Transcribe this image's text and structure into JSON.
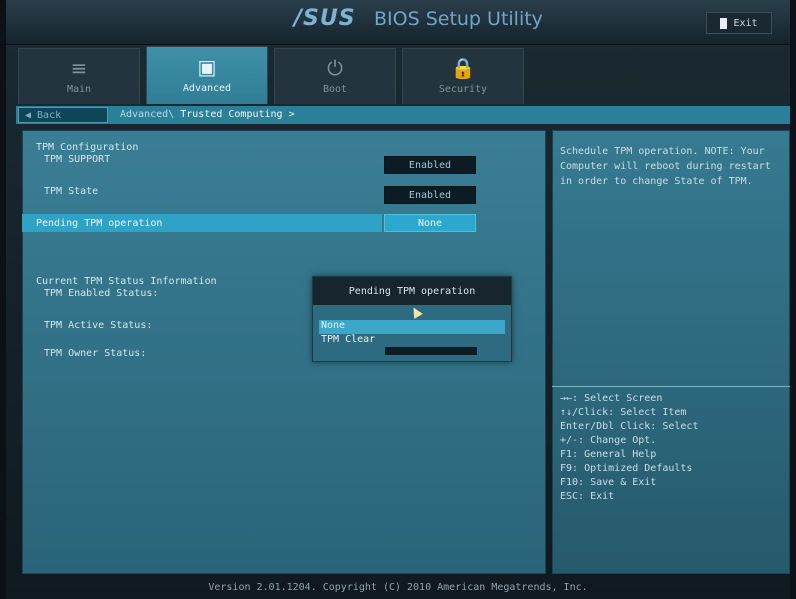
{
  "header": {
    "logo": "/SUS",
    "title": "BIOS Setup Utility",
    "exit_label": "Exit"
  },
  "tabs": [
    {
      "label": "Main",
      "icon": "≡"
    },
    {
      "label": "Advanced",
      "icon": "▣"
    },
    {
      "label": "Boot",
      "icon": "⏻"
    },
    {
      "label": "Security",
      "icon": "🔒"
    }
  ],
  "breadcrumb": {
    "back_label": "Back",
    "path_prefix": "Advanced\\",
    "path_current": "Trusted Computing >"
  },
  "config": {
    "section_title": "TPM Configuration",
    "items": [
      {
        "label": "TPM SUPPORT",
        "value": "Enabled"
      },
      {
        "label": "TPM State",
        "value": "Enabled"
      },
      {
        "label": "Pending TPM operation",
        "value": "None"
      }
    ],
    "status_title": "Current TPM Status Information",
    "status_items": [
      {
        "label": "TPM Enabled Status:"
      },
      {
        "label": "TPM Active Status:"
      },
      {
        "label": "TPM Owner Status:"
      }
    ]
  },
  "popup": {
    "title": "Pending TPM operation",
    "options": [
      "None",
      "TPM Clear"
    ],
    "selected": "None"
  },
  "help": {
    "description": [
      "Schedule TPM operation. NOTE: Your",
      "Computer will reboot during restart",
      "in order to change State of TPM."
    ],
    "keys": [
      "→←: Select Screen",
      "↑↓/Click: Select Item",
      "Enter/Dbl Click: Select",
      "+/-: Change Opt.",
      "F1: General Help",
      "F9: Optimized Defaults",
      "F10: Save & Exit",
      "ESC: Exit"
    ]
  },
  "footer": "Version 2.01.1204. Copyright (C) 2010 American Megatrends, Inc."
}
